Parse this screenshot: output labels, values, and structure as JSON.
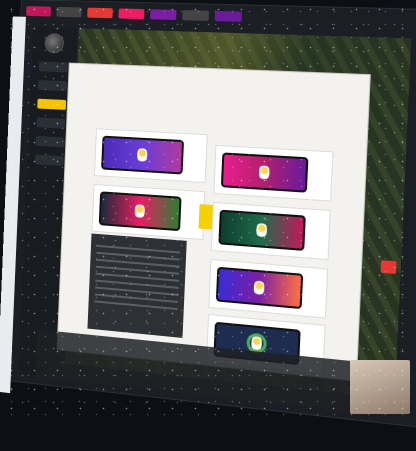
{
  "top_tabs": [
    {
      "label": "",
      "color": "#c2185b"
    },
    {
      "label": "",
      "color": "#444444"
    },
    {
      "label": "",
      "color": "#e53935"
    },
    {
      "label": "",
      "color": "#e91e63"
    },
    {
      "label": "",
      "color": "#7b1fa2"
    },
    {
      "label": "",
      "color": "#444444"
    },
    {
      "label": "",
      "color": "#6a1b9a"
    }
  ],
  "left_strip": {
    "label": "",
    "icon": "app-icon"
  },
  "nav": {
    "avatar_icon": "avatar-icon",
    "items": [
      {
        "label": "",
        "active": false
      },
      {
        "label": "",
        "active": false
      },
      {
        "label": "",
        "active": true
      },
      {
        "label": "",
        "active": false
      },
      {
        "label": "",
        "active": false
      },
      {
        "label": "",
        "active": false
      }
    ]
  },
  "menu": {
    "rows": [
      [
        "",
        "",
        "",
        "",
        "",
        "",
        ""
      ],
      [
        "",
        "",
        "",
        "",
        "",
        "",
        ""
      ],
      [
        "",
        "",
        "",
        "",
        "",
        "",
        ""
      ],
      [
        "",
        "",
        "",
        "",
        "",
        "",
        ""
      ],
      [
        "",
        "",
        "",
        "",
        "",
        "",
        ""
      ]
    ]
  },
  "products": [
    {
      "name": "keyboard-product-1",
      "theme": "#5b2bd6",
      "badge": ""
    },
    {
      "name": "keyboard-product-2",
      "theme": "#e91e8c",
      "badge": ""
    },
    {
      "name": "keyboard-product-3",
      "theme": "#1b2a3a",
      "badge": ""
    },
    {
      "name": "keyboard-product-4",
      "theme": "#1e6b4b",
      "badge": ""
    },
    {
      "name": "keyboard-product-5",
      "theme": "#3b2bd6",
      "badge": ""
    },
    {
      "name": "keyboard-product-6",
      "theme": "#1d2c4f",
      "badge": ""
    }
  ],
  "info_box": {
    "lines": 9
  },
  "side_badge": {
    "label": "",
    "color": "#e53935"
  },
  "bottom_text": [
    "",
    "",
    "",
    ""
  ]
}
